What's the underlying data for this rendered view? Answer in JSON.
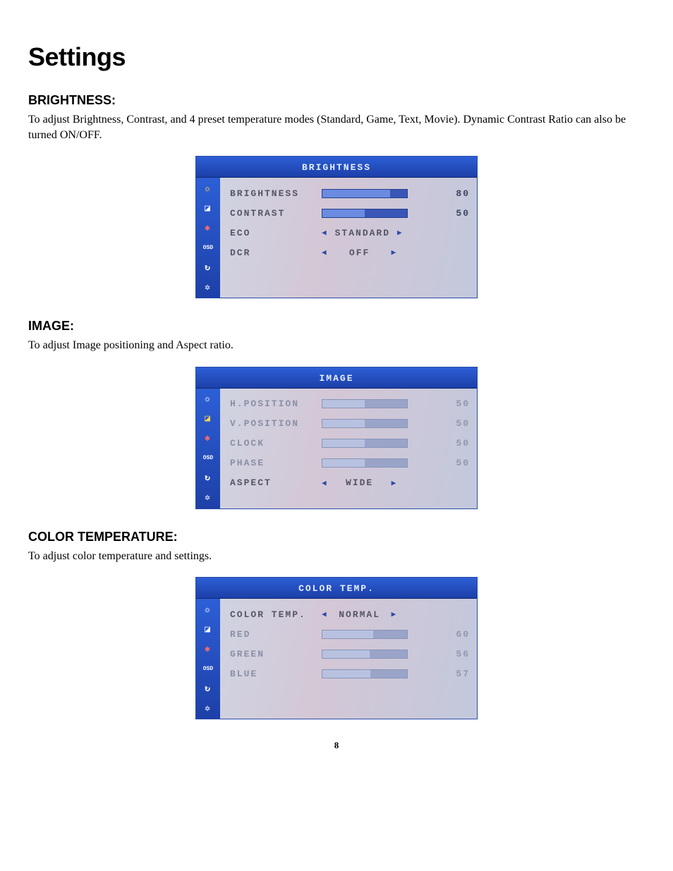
{
  "page": {
    "title": "Settings",
    "page_number": "8"
  },
  "sections": {
    "brightness": {
      "heading": "BRIGHTNESS:",
      "body": "To adjust Brightness, Contrast, and 4 preset temperature modes (Standard, Game, Text, Movie). Dynamic Contrast Ratio can also be turned ON/OFF."
    },
    "image": {
      "heading": "IMAGE:",
      "body": "To adjust Image positioning and Aspect ratio."
    },
    "color": {
      "heading": "COLOR TEMPERATURE:",
      "body": "To adjust color temperature and settings."
    }
  },
  "osd_icons": {
    "sun": "☼",
    "picture": "◪",
    "color": "✱",
    "osd": "OSD",
    "reset": "↻",
    "misc": "✲"
  },
  "osd_brightness": {
    "title": "BRIGHTNESS",
    "rows": {
      "brightness": {
        "label": "BRIGHTNESS",
        "value": "80",
        "fill_pct": 80
      },
      "contrast": {
        "label": "CONTRAST",
        "value": "50",
        "fill_pct": 50
      },
      "eco": {
        "label": "ECO",
        "value": "STANDARD"
      },
      "dcr": {
        "label": "DCR",
        "value": "OFF"
      }
    }
  },
  "osd_image": {
    "title": "IMAGE",
    "rows": {
      "hpos": {
        "label": "H.POSITION",
        "value": "50",
        "fill_pct": 50
      },
      "vpos": {
        "label": "V.POSITION",
        "value": "50",
        "fill_pct": 50
      },
      "clock": {
        "label": "CLOCK",
        "value": "50",
        "fill_pct": 50
      },
      "phase": {
        "label": "PHASE",
        "value": "50",
        "fill_pct": 50
      },
      "aspect": {
        "label": "ASPECT",
        "value": "WIDE"
      }
    }
  },
  "osd_color": {
    "title": "COLOR TEMP.",
    "rows": {
      "mode": {
        "label": "COLOR TEMP.",
        "value": "NORMAL"
      },
      "red": {
        "label": "RED",
        "value": "60",
        "fill_pct": 60
      },
      "green": {
        "label": "GREEN",
        "value": "56",
        "fill_pct": 56
      },
      "blue": {
        "label": "BLUE",
        "value": "57",
        "fill_pct": 57
      }
    }
  },
  "arrows": {
    "left": "◀",
    "right": "▶"
  }
}
